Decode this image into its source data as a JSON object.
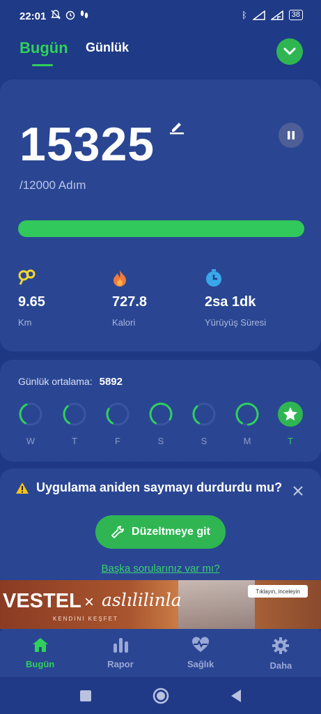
{
  "status_bar": {
    "time": "22:01",
    "battery": "38"
  },
  "tabs": {
    "today": "Bugün",
    "daily": "Günlük"
  },
  "steps": {
    "count": "15325",
    "goal": "/12000 Adım",
    "progress": 1.0
  },
  "stats": [
    {
      "value": "9.65",
      "label": "Km",
      "icon": "footsteps-icon",
      "color": "#f2d72e"
    },
    {
      "value": "727.8",
      "label": "Kalori",
      "icon": "flame-icon",
      "color": "#f07b3b"
    },
    {
      "value": "2sa 1dk",
      "label": "Yürüyüş Süresi",
      "icon": "stopwatch-icon",
      "color": "#3aa7e8"
    }
  ],
  "daily_average": {
    "label": "Günlük ortalama:",
    "value": "5892"
  },
  "week": [
    {
      "day": "W",
      "progress": 0.35
    },
    {
      "day": "T",
      "progress": 0.3
    },
    {
      "day": "F",
      "progress": 0.25
    },
    {
      "day": "S",
      "progress": 0.75
    },
    {
      "day": "S",
      "progress": 0.3
    },
    {
      "day": "M",
      "progress": 0.9
    },
    {
      "day": "T",
      "progress": 1.0
    }
  ],
  "alert": {
    "title": "Uygulama aniden saymayı durdurdu mu?",
    "button": "Düzeltmeye git",
    "link": "Başka sorularınız var mı?"
  },
  "ad": {
    "brand": "VESTEL",
    "x": "×",
    "partner": "aslılilinla",
    "tagline": "KENDİNİ KEŞFET",
    "cta": "Tıklayın, inceleyin"
  },
  "nav": [
    {
      "label": "Bugün",
      "icon": "home-icon",
      "active": true
    },
    {
      "label": "Rapor",
      "icon": "bar-chart-icon",
      "active": false
    },
    {
      "label": "Sağlık",
      "icon": "heart-pulse-icon",
      "active": false
    },
    {
      "label": "Daha",
      "icon": "gear-icon",
      "active": false
    }
  ],
  "colors": {
    "accent": "#2fd05b",
    "background": "#1f3a86",
    "card": "#2a4693"
  }
}
